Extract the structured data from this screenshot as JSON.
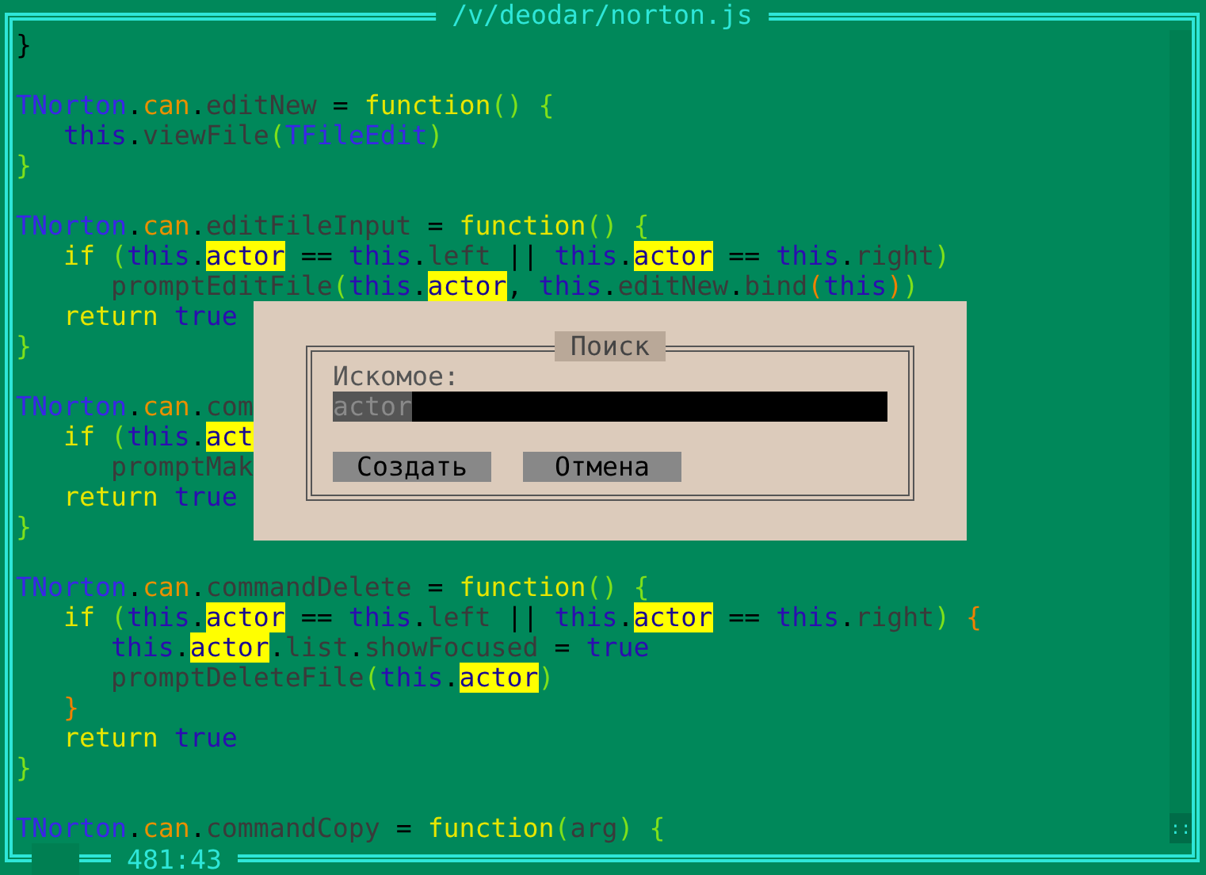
{
  "editor": {
    "title": "/v/deodar/norton.js",
    "cursor_position": "481:43",
    "scrollbar": {
      "thumb": "::"
    },
    "lines": [
      {
        "kind": "code",
        "tokens": [
          {
            "text": "}",
            "kind": "op"
          }
        ]
      },
      {
        "kind": "blank"
      },
      {
        "kind": "code",
        "tokens": [
          {
            "text": "TNorton",
            "kind": "class"
          },
          {
            "text": ".",
            "kind": "op"
          },
          {
            "text": "can",
            "kind": "prop"
          },
          {
            "text": ".",
            "kind": "op"
          },
          {
            "text": "editNew",
            "kind": "name"
          },
          {
            "text": " = ",
            "kind": "op"
          },
          {
            "text": "function",
            "kind": "kw"
          },
          {
            "text": "()",
            "kind": "paren"
          },
          {
            "text": " {",
            "kind": "paren"
          }
        ]
      },
      {
        "kind": "code",
        "tokens": [
          {
            "text": "   this",
            "kind": "this"
          },
          {
            "text": ".",
            "kind": "op"
          },
          {
            "text": "viewFile",
            "kind": "name"
          },
          {
            "text": "(",
            "kind": "paren"
          },
          {
            "text": "TFileEdit",
            "kind": "class"
          },
          {
            "text": ")",
            "kind": "paren"
          }
        ]
      },
      {
        "kind": "code",
        "tokens": [
          {
            "text": "}",
            "kind": "paren"
          }
        ]
      },
      {
        "kind": "blank"
      },
      {
        "kind": "code",
        "tokens": [
          {
            "text": "TNorton",
            "kind": "class"
          },
          {
            "text": ".",
            "kind": "op"
          },
          {
            "text": "can",
            "kind": "prop"
          },
          {
            "text": ".",
            "kind": "op"
          },
          {
            "text": "editFileInput",
            "kind": "name"
          },
          {
            "text": " = ",
            "kind": "op"
          },
          {
            "text": "function",
            "kind": "kw"
          },
          {
            "text": "()",
            "kind": "paren"
          },
          {
            "text": " {",
            "kind": "paren"
          }
        ]
      },
      {
        "kind": "code",
        "tokens": [
          {
            "text": "   if",
            "kind": "kw"
          },
          {
            "text": " (",
            "kind": "paren"
          },
          {
            "text": "this",
            "kind": "this"
          },
          {
            "text": ".",
            "kind": "op"
          },
          {
            "text": "actor",
            "kind": "match"
          },
          {
            "text": " == ",
            "kind": "op"
          },
          {
            "text": "this",
            "kind": "this"
          },
          {
            "text": ".",
            "kind": "op"
          },
          {
            "text": "left",
            "kind": "name"
          },
          {
            "text": " || ",
            "kind": "op"
          },
          {
            "text": "this",
            "kind": "this"
          },
          {
            "text": ".",
            "kind": "op"
          },
          {
            "text": "actor",
            "kind": "match"
          },
          {
            "text": " == ",
            "kind": "op"
          },
          {
            "text": "this",
            "kind": "this"
          },
          {
            "text": ".",
            "kind": "op"
          },
          {
            "text": "right",
            "kind": "name"
          },
          {
            "text": ")",
            "kind": "paren"
          }
        ]
      },
      {
        "kind": "code",
        "tokens": [
          {
            "text": "      promptEditFile",
            "kind": "name"
          },
          {
            "text": "(",
            "kind": "paren"
          },
          {
            "text": "this",
            "kind": "this"
          },
          {
            "text": ".",
            "kind": "op"
          },
          {
            "text": "actor",
            "kind": "match"
          },
          {
            "text": ", ",
            "kind": "op"
          },
          {
            "text": "this",
            "kind": "this"
          },
          {
            "text": ".",
            "kind": "op"
          },
          {
            "text": "editNew",
            "kind": "name"
          },
          {
            "text": ".",
            "kind": "op"
          },
          {
            "text": "bind",
            "kind": "name"
          },
          {
            "text": "(",
            "kind": "paren2"
          },
          {
            "text": "this",
            "kind": "this"
          },
          {
            "text": ")",
            "kind": "paren2"
          },
          {
            "text": ")",
            "kind": "paren"
          }
        ]
      },
      {
        "kind": "code",
        "tokens": [
          {
            "text": "   return",
            "kind": "kw"
          },
          {
            "text": " true",
            "kind": "this"
          }
        ]
      },
      {
        "kind": "code",
        "tokens": [
          {
            "text": "}",
            "kind": "paren"
          }
        ]
      },
      {
        "kind": "blank"
      },
      {
        "kind": "code",
        "tokens": [
          {
            "text": "TNorton",
            "kind": "class"
          },
          {
            "text": ".",
            "kind": "op"
          },
          {
            "text": "can",
            "kind": "prop"
          },
          {
            "text": ".",
            "kind": "op"
          },
          {
            "text": "com",
            "kind": "name"
          }
        ]
      },
      {
        "kind": "code",
        "tokens": [
          {
            "text": "   if",
            "kind": "kw"
          },
          {
            "text": " (",
            "kind": "paren"
          },
          {
            "text": "this",
            "kind": "this"
          },
          {
            "text": ".",
            "kind": "op"
          },
          {
            "text": "act",
            "kind": "match"
          }
        ]
      },
      {
        "kind": "code",
        "tokens": [
          {
            "text": "      promptMak",
            "kind": "name"
          }
        ]
      },
      {
        "kind": "code",
        "tokens": [
          {
            "text": "   return",
            "kind": "kw"
          },
          {
            "text": " true",
            "kind": "this"
          }
        ]
      },
      {
        "kind": "code",
        "tokens": [
          {
            "text": "}",
            "kind": "paren"
          }
        ]
      },
      {
        "kind": "blank"
      },
      {
        "kind": "code",
        "tokens": [
          {
            "text": "TNorton",
            "kind": "class"
          },
          {
            "text": ".",
            "kind": "op"
          },
          {
            "text": "can",
            "kind": "prop"
          },
          {
            "text": ".",
            "kind": "op"
          },
          {
            "text": "commandDelete",
            "kind": "name"
          },
          {
            "text": " = ",
            "kind": "op"
          },
          {
            "text": "function",
            "kind": "kw"
          },
          {
            "text": "()",
            "kind": "paren"
          },
          {
            "text": " {",
            "kind": "paren"
          }
        ]
      },
      {
        "kind": "code",
        "tokens": [
          {
            "text": "   if",
            "kind": "kw"
          },
          {
            "text": " (",
            "kind": "paren"
          },
          {
            "text": "this",
            "kind": "this"
          },
          {
            "text": ".",
            "kind": "op"
          },
          {
            "text": "actor",
            "kind": "match"
          },
          {
            "text": " == ",
            "kind": "op"
          },
          {
            "text": "this",
            "kind": "this"
          },
          {
            "text": ".",
            "kind": "op"
          },
          {
            "text": "left",
            "kind": "name"
          },
          {
            "text": " || ",
            "kind": "op"
          },
          {
            "text": "this",
            "kind": "this"
          },
          {
            "text": ".",
            "kind": "op"
          },
          {
            "text": "actor",
            "kind": "match"
          },
          {
            "text": " == ",
            "kind": "op"
          },
          {
            "text": "this",
            "kind": "this"
          },
          {
            "text": ".",
            "kind": "op"
          },
          {
            "text": "right",
            "kind": "name"
          },
          {
            "text": ")",
            "kind": "paren"
          },
          {
            "text": " {",
            "kind": "paren2"
          }
        ]
      },
      {
        "kind": "code",
        "tokens": [
          {
            "text": "      this",
            "kind": "this"
          },
          {
            "text": ".",
            "kind": "op"
          },
          {
            "text": "actor",
            "kind": "match"
          },
          {
            "text": ".",
            "kind": "op"
          },
          {
            "text": "list",
            "kind": "name"
          },
          {
            "text": ".",
            "kind": "op"
          },
          {
            "text": "showFocused",
            "kind": "name"
          },
          {
            "text": " = ",
            "kind": "op"
          },
          {
            "text": "true",
            "kind": "this"
          }
        ]
      },
      {
        "kind": "code",
        "tokens": [
          {
            "text": "      promptDeleteFile",
            "kind": "name"
          },
          {
            "text": "(",
            "kind": "paren"
          },
          {
            "text": "this",
            "kind": "this"
          },
          {
            "text": ".",
            "kind": "op"
          },
          {
            "text": "actor",
            "kind": "match"
          },
          {
            "text": ")",
            "kind": "paren"
          }
        ]
      },
      {
        "kind": "code",
        "tokens": [
          {
            "text": "   }",
            "kind": "paren2"
          }
        ]
      },
      {
        "kind": "code",
        "tokens": [
          {
            "text": "   return",
            "kind": "kw"
          },
          {
            "text": " true",
            "kind": "this"
          }
        ]
      },
      {
        "kind": "code",
        "tokens": [
          {
            "text": "}",
            "kind": "paren"
          }
        ]
      },
      {
        "kind": "blank"
      },
      {
        "kind": "code",
        "tokens": [
          {
            "text": "TNorton",
            "kind": "class"
          },
          {
            "text": ".",
            "kind": "op"
          },
          {
            "text": "can",
            "kind": "prop"
          },
          {
            "text": ".",
            "kind": "op"
          },
          {
            "text": "commandCopy",
            "kind": "name"
          },
          {
            "text": " = ",
            "kind": "op"
          },
          {
            "text": "function",
            "kind": "kw"
          },
          {
            "text": "(",
            "kind": "paren"
          },
          {
            "text": "arg",
            "kind": "name"
          },
          {
            "text": ")",
            "kind": "paren"
          },
          {
            "text": " {",
            "kind": "paren"
          }
        ]
      }
    ]
  },
  "dialog": {
    "title": "Поиск",
    "label": "Искомое:",
    "field": {
      "value": "actor",
      "value_selected": true
    },
    "buttons": [
      {
        "label": "Создать"
      },
      {
        "label": "Отмена"
      }
    ]
  }
}
